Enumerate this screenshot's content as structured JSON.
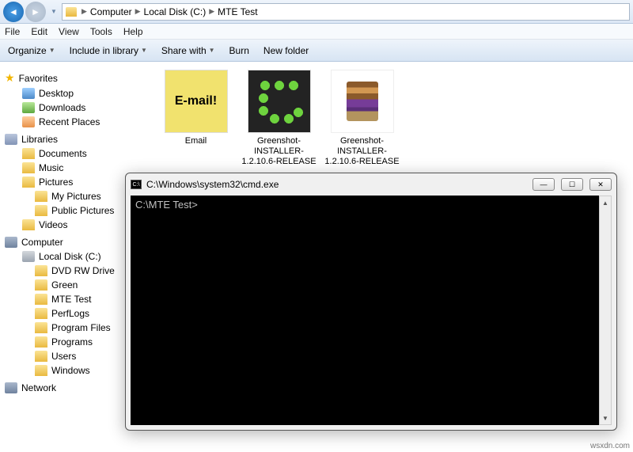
{
  "breadcrumb": {
    "root": "Computer",
    "drive": "Local Disk (C:)",
    "folder": "MTE Test"
  },
  "menu": {
    "file": "File",
    "edit": "Edit",
    "view": "View",
    "tools": "Tools",
    "help": "Help"
  },
  "toolbar": {
    "organize": "Organize",
    "include": "Include in library",
    "share": "Share with",
    "burn": "Burn",
    "newfolder": "New folder"
  },
  "sidebar": {
    "favorites": "Favorites",
    "fav_items": [
      "Desktop",
      "Downloads",
      "Recent Places"
    ],
    "libraries": "Libraries",
    "lib_items": [
      "Documents",
      "Music",
      "Pictures",
      "Videos"
    ],
    "pic_sub": [
      "My Pictures",
      "Public Pictures"
    ],
    "computer": "Computer",
    "disk": "Local Disk (C:)",
    "disk_items": [
      "DVD RW Drive",
      "Green",
      "MTE Test",
      "PerfLogs",
      "Program Files",
      "Programs",
      "Users",
      "Windows"
    ],
    "network": "Network"
  },
  "files": [
    {
      "name": "Email",
      "thumb_text": "E-mail!"
    },
    {
      "name": "Greenshot-INSTALLER-1.2.10.6-RELEASE"
    },
    {
      "name": "Greenshot-INSTALLER-1.2.10.6-RELEASE"
    }
  ],
  "cmd": {
    "title": "C:\\Windows\\system32\\cmd.exe",
    "prompt": "C:\\MTE Test>"
  },
  "watermark": "wsxdn.com"
}
